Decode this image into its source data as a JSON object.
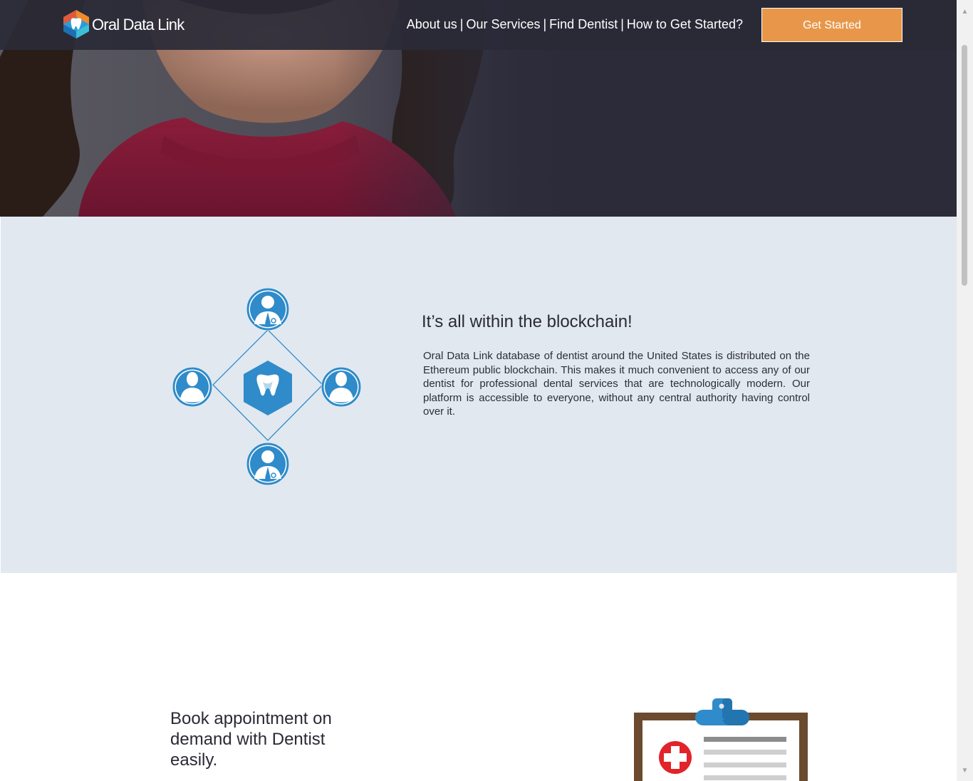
{
  "brand": {
    "name": "Oral Data Link"
  },
  "nav": {
    "links": [
      "About us",
      "Our Services",
      "Find Dentist",
      "How to Get Started?"
    ],
    "separator": "|",
    "cta_label": "Get Started"
  },
  "blockchain": {
    "heading": "It’s all within the blockchain!",
    "body": "Oral Data Link database of dentist around the United States is distributed on the Ethereum public blockchain. This makes it much convenient to access any of our dentist for professional dental services that are technologically modern. Our platform is accessible to everyone, without any central authority having control over it."
  },
  "booking": {
    "heading": "Book appointment on demand with Dentist easily."
  },
  "scrollbar": {
    "up_glyph": "▲",
    "down_glyph": "▼"
  },
  "colors": {
    "nav_bg": "#2a2a37",
    "cta_orange": "#e8974a",
    "section_bg": "#e1e8f0",
    "accent_blue": "#2f8bc9",
    "hero_dark": "#2c2b3a"
  },
  "icons": {
    "logo": "tooth-hexagon-logo",
    "dentist": "dentist-avatar-icon",
    "patient": "patient-avatar-icon",
    "center": "tooth-hexagon-icon",
    "clipboard": "medical-clipboard-illustration"
  }
}
